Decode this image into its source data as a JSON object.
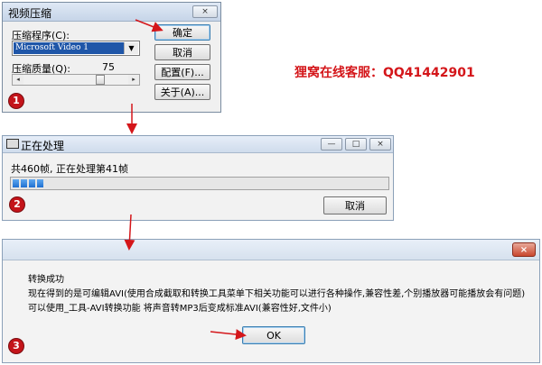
{
  "colors": {
    "accent_red": "#d4161a",
    "selection_blue": "#1f56a8",
    "progress_blue": "#1e6fd0"
  },
  "annotation_note": "狸窝在线客服：QQ41442901",
  "window1": {
    "title": "视频压缩",
    "close_icon_glyph": "×",
    "compressor_label": "压缩程序(C):",
    "compressor_value": "Microsoft Video 1",
    "dropdown_glyph": "▼",
    "quality_label": "压缩质量(Q):",
    "quality_value": "75",
    "quality_level": 0.75,
    "scroll_left_glyph": "◂",
    "scroll_right_glyph": "▸",
    "ok_label": "确定",
    "cancel_label": "取消",
    "configure_label": "配置(F)...",
    "about_label": "关于(A)...",
    "badge": "1"
  },
  "window2": {
    "title": "正在处理",
    "status_text": "共460帧, 正在处理第41帧",
    "progress_fraction": 0.089,
    "cancel_label": "取消",
    "min_glyph": "—",
    "max_glyph": "□",
    "close_glyph": "×",
    "badge": "2"
  },
  "window3": {
    "close_glyph": "×",
    "line1": "转换成功",
    "line2": "现在得到的是可编辑AVI(使用合成截取和转换工具菜单下相关功能可以进行各种操作,兼容性差,个别播放器可能播放会有问题)",
    "line3": "可以使用_工具-AVI转换功能 将声音转MP3后变成标准AVI(兼容性好,文件小)",
    "ok_label": "OK",
    "badge": "3"
  }
}
